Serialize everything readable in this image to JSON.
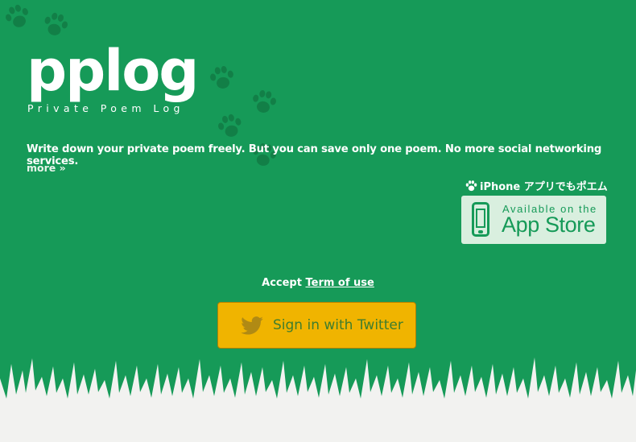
{
  "logo": {
    "title": "pplog",
    "tagline": "Private Poem Log"
  },
  "description": "Write down your private poem freely. But you can save only one poem. No more social networking services.",
  "more_link": "more »",
  "iphone_app": {
    "label": "iPhone アプリでもポエム",
    "icon": "paw-icon"
  },
  "app_store": {
    "line1": "Available on the",
    "line2": "App Store",
    "icon": "iphone-icon"
  },
  "accept": {
    "prefix": "Accept ",
    "link": "Term of use"
  },
  "signin": {
    "label": "Sign in with Twitter",
    "icon": "twitter-bird-icon"
  },
  "colors": {
    "background": "#169a58",
    "button": "#f0b400",
    "grass": "#f2f2f0",
    "paw": "#117a44"
  }
}
